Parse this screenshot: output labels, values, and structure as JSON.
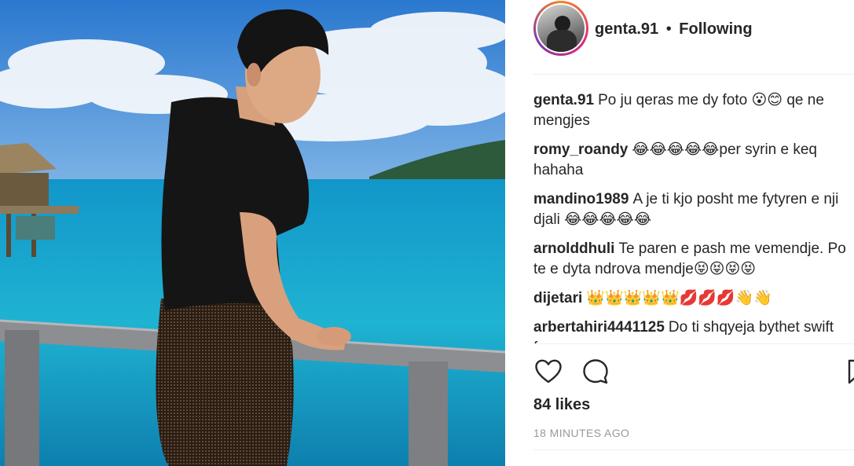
{
  "post": {
    "username": "genta.91",
    "separator": "•",
    "follow_state": "Following",
    "likes_text": "84 likes",
    "timestamp": "18 MINUTES AGO"
  },
  "comments": [
    {
      "user": "genta.91",
      "text": "Po ju qeras me dy foto 😮😊 qe ne mengjes"
    },
    {
      "user": "romy_roandy",
      "text": "😂😂😂😂😂per syrin e keq hahaha"
    },
    {
      "user": "mandino1989",
      "text": "A je ti kjo posht me fytyren e nji djali 😂😂😂😂😂"
    },
    {
      "user": "arnolddhuli",
      "text": "Te paren e pash me vemendje. Po te e dyta ndrova mendje😝😝😝😝"
    },
    {
      "user": "dijetari",
      "text": "👑👑👑👑👑💋💋💋👋👋"
    },
    {
      "user": "arbertahiri4441125",
      "text": "Do ti shqyeja bythet swift faqe"
    }
  ],
  "icons": {
    "like": "heart-icon",
    "comment": "comment-bubble-icon",
    "save": "bookmark-icon"
  },
  "colors": {
    "sky": "#2f86d8",
    "sea": "#1ab1cf",
    "text": "#262626",
    "muted": "#999999"
  }
}
